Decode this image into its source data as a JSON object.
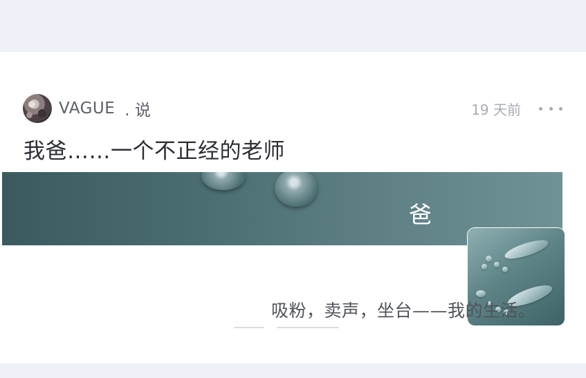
{
  "post": {
    "author_name": "VAGUE",
    "author_action": ". 说",
    "timestamp": "19 天前",
    "more_icon": "more-horizontal-icon",
    "title": "我爸……一个不正经的老师",
    "banner_char": "爸",
    "subtitle": "吸粉，卖声，坐台——我的生活。"
  },
  "colors": {
    "page_background": "#eef1f7",
    "card_background": "#ffffff",
    "banner_teal": "#4a6d72",
    "title_text": "#2b2e33",
    "meta_text": "#a8adb4"
  }
}
